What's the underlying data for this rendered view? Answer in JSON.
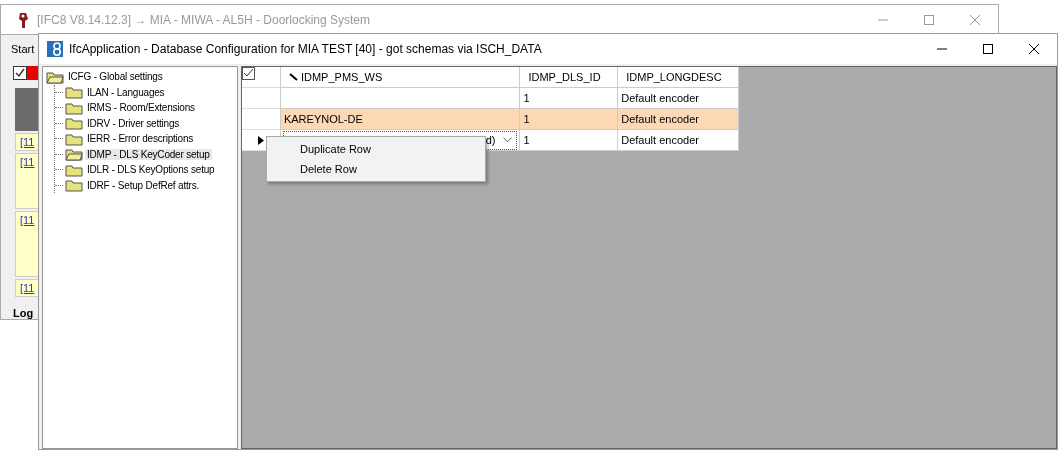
{
  "back_window": {
    "title": "[IFC8 V8.14.12.3] → MIA - MIWA - AL5H - Doorlocking System",
    "menu": "Start",
    "log_links": [
      "[11",
      "[11",
      "[11",
      "[11"
    ],
    "log_label": "Log"
  },
  "window": {
    "title": "IfcApplication - Database Configuration for MIA TEST [40] - got schemas via ISCH_DATA"
  },
  "tree": {
    "label": "ICFG - Global settings",
    "expanded": true,
    "children": [
      {
        "label": "ILAN - Languages",
        "selected": false
      },
      {
        "label": "IRMS - Room/Extensions",
        "selected": false
      },
      {
        "label": "IDRV - Driver settings",
        "selected": false
      },
      {
        "label": "IERR - Error descriptions",
        "selected": false
      },
      {
        "label": "IDMP - DLS KeyCoder setup",
        "selected": true
      },
      {
        "label": "IDLR - DLS KeyOptions setup",
        "selected": false
      },
      {
        "label": "IDRF - Setup DefRef attrs.",
        "selected": false
      }
    ]
  },
  "table": {
    "columns": [
      "IDMP_PMS_WS",
      "IDMP_DLS_ID",
      "IDMP_LONGDESC"
    ],
    "rows": [
      {
        "cells": [
          "",
          "1",
          "Default encoder"
        ],
        "selected": false,
        "current": false
      },
      {
        "cells": [
          "KAREYNOL-DE",
          "1",
          "Default encoder"
        ],
        "selected": true,
        "current": false
      },
      {
        "cells": [
          "d)",
          "1",
          "Default encoder"
        ],
        "selected": false,
        "current": true
      }
    ]
  },
  "context_menu": [
    "Duplicate Row",
    "Delete Row"
  ]
}
